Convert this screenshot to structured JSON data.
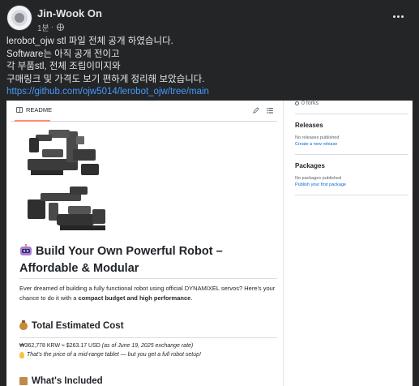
{
  "post": {
    "author": "Jin-Wook On",
    "time": "1분",
    "lines": [
      "lerobot_ojw stl 파일 전체 공개 하였습니다.",
      "Software는 아직 공개 전이고",
      "각 부품stl, 전체 조립이미지와",
      "구매링크 및 가격도 보기 편하게 정리해 보았습니다."
    ],
    "link": "https://github.com/ojw5014/lerobot_ojw/tree/main"
  },
  "icons": {
    "avatar": "avatar-icon",
    "privacy": "globe-icon",
    "more": "more-options-icon",
    "readme": "book-icon",
    "edit": "pencil-icon",
    "outline": "list-icon",
    "title_emoji": "robot-icon",
    "cost_emoji": "money-bag-icon",
    "tip_emoji": "lightbulb-icon",
    "included_emoji": "package-icon"
  },
  "colors": {
    "background": "#242526",
    "link": "#4599ff",
    "github_link": "#0969da",
    "readme_tab_accent": "#fd8c73"
  },
  "readme": {
    "tab_label": "README",
    "title": "Build Your Own Powerful Robot – Affordable & Modular",
    "intro_prefix": "Ever dreamed of building a fully functional robot using official DYNAMIXEL servos? Here's your chance to do it with a ",
    "intro_bold": "compact budget and high performance",
    "intro_suffix": ".",
    "cost_heading": "Total Estimated Cost",
    "cost_value": "₩362,778 KRW ≈ $263.17 USD",
    "cost_note": "(as of June 19, 2025 exchange rate)",
    "tip": "That's the price of a mid-range tablet — but you get a full robot setup!",
    "included_heading": "What's Included"
  },
  "sidebar": {
    "forks": "0 forks",
    "releases_heading": "Releases",
    "releases_note": "No releases published",
    "releases_link": "Create a new release",
    "packages_heading": "Packages",
    "packages_note": "No packages published",
    "packages_link": "Publish your first package"
  }
}
